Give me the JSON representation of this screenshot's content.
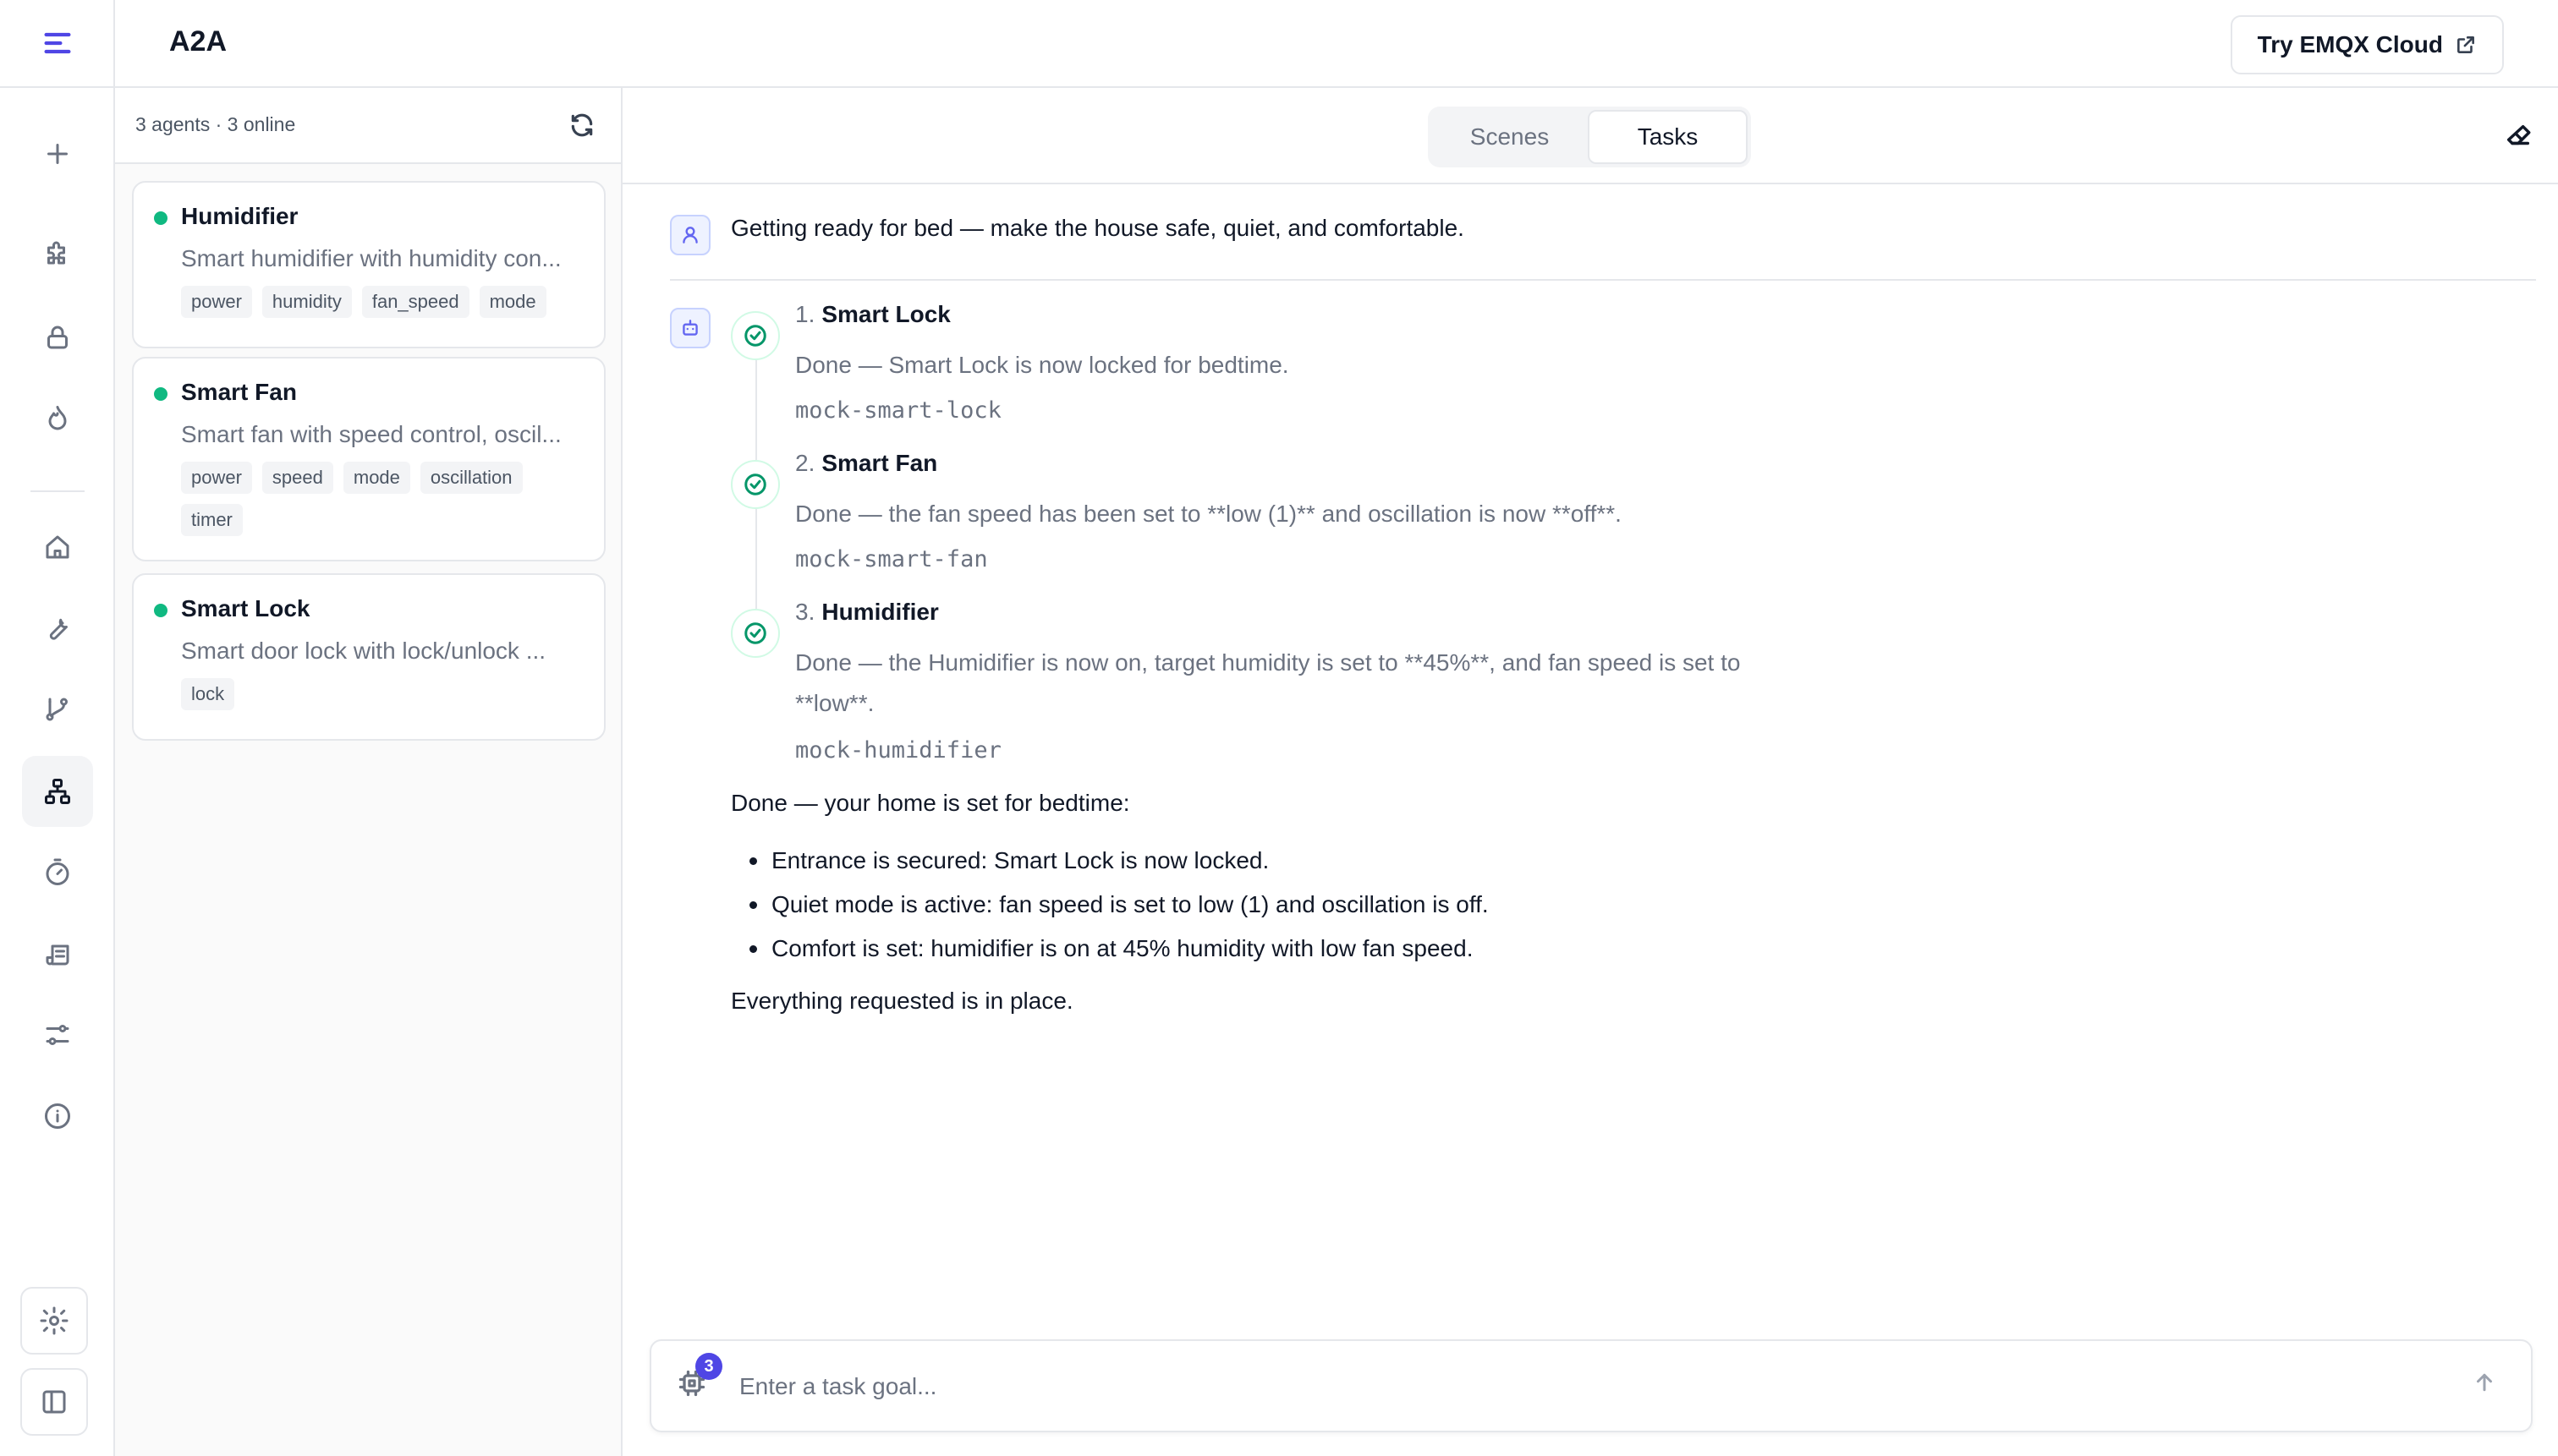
{
  "header": {
    "app_title": "A2A",
    "cloud_button": "Try EMQX Cloud"
  },
  "agents_panel": {
    "count_text": "3 agents · 3 online",
    "agents": [
      {
        "name": "Humidifier",
        "status_color": "#10b981",
        "description": "Smart humidifier with humidity con...",
        "tags": [
          "power",
          "humidity",
          "fan_speed",
          "mode"
        ]
      },
      {
        "name": "Smart Fan",
        "status_color": "#10b981",
        "description": "Smart fan with speed control, oscil...",
        "tags": [
          "power",
          "speed",
          "mode",
          "oscillation",
          "timer"
        ]
      },
      {
        "name": "Smart Lock",
        "status_color": "#10b981",
        "description": "Smart door lock with lock/unlock ...",
        "tags": [
          "lock"
        ]
      }
    ]
  },
  "tabs": {
    "items": [
      "Scenes",
      "Tasks"
    ],
    "active": "Tasks"
  },
  "conversation": {
    "user_message": "Getting ready for bed — make the house safe, quiet, and comfortable.",
    "steps": [
      {
        "number": "1.",
        "title": "Smart Lock",
        "body": "Done — Smart Lock is now locked for bedtime.",
        "agent_id": "mock-smart-lock"
      },
      {
        "number": "2.",
        "title": "Smart Fan",
        "body": "Done — the fan speed has been set to **low (1)** and oscillation is now **off**.",
        "agent_id": "mock-smart-fan"
      },
      {
        "number": "3.",
        "title": "Humidifier",
        "body": "Done — the Humidifier is now on, target humidity is set to **45%**, and fan speed is set to **low**.",
        "agent_id": "mock-humidifier"
      }
    ],
    "summary": {
      "intro": "Done — your home is set for bedtime:",
      "bullets": [
        "Entrance is secured: Smart Lock is now locked.",
        "Quiet mode is active: fan speed is set to low (1) and oscillation is off.",
        "Comfort is set: humidifier is on at 45% humidity with low fan speed."
      ],
      "outro": "Everything requested is in place."
    }
  },
  "composer": {
    "placeholder": "Enter a task goal...",
    "agent_badge": "3"
  },
  "icons": {
    "rail": [
      "menu-icon",
      "plus-icon",
      "puzzle-icon",
      "lock-icon",
      "flame-icon",
      "home-icon",
      "wrench-icon",
      "git-branch-icon",
      "network-icon",
      "timer-icon",
      "scroll-icon",
      "sliders-icon",
      "info-icon",
      "settings-icon",
      "sidebar-toggle-icon"
    ]
  },
  "colors": {
    "accent": "#4f46e5",
    "online": "#10b981",
    "success": "#059669"
  }
}
